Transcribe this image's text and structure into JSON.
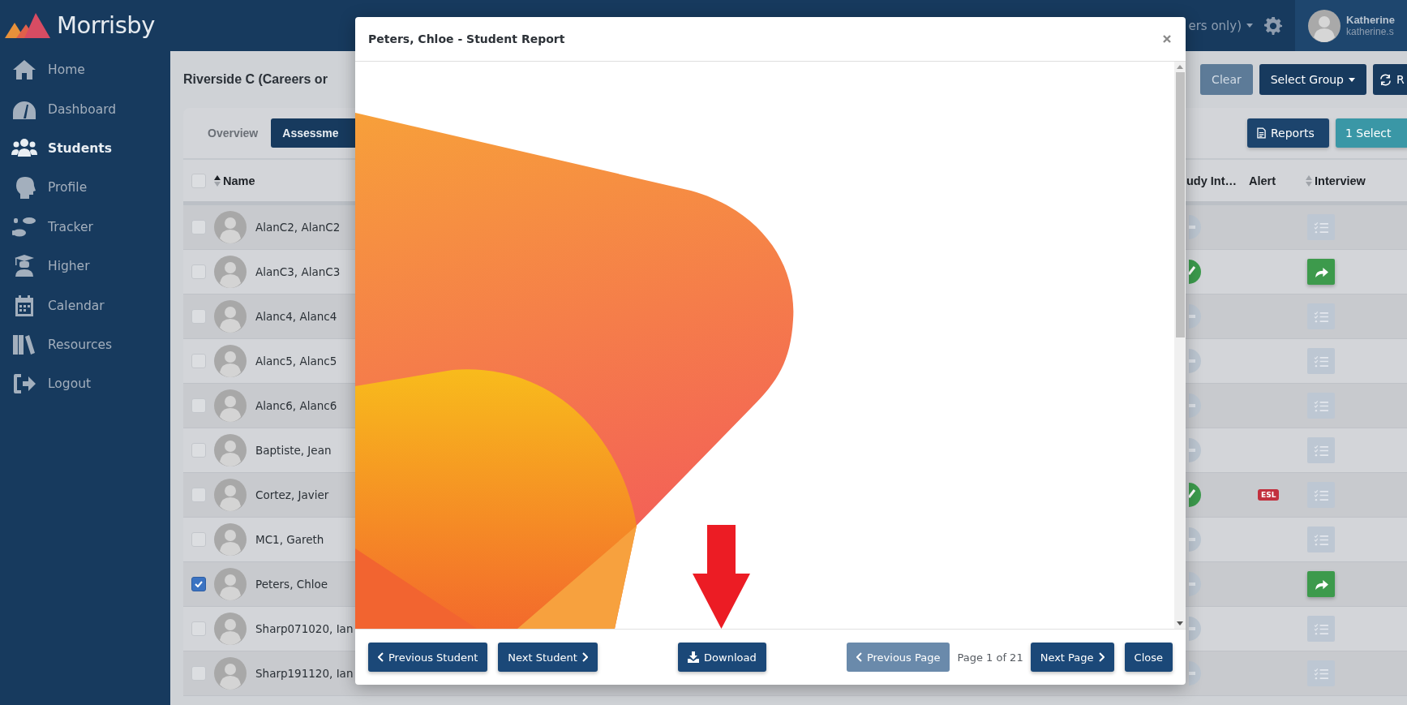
{
  "brand": {
    "name": "Morrisby"
  },
  "sidebar": {
    "items": [
      {
        "label": "Home",
        "selected": false
      },
      {
        "label": "Dashboard",
        "selected": false
      },
      {
        "label": "Students",
        "selected": true
      },
      {
        "label": "Profile",
        "selected": false
      },
      {
        "label": "Tracker",
        "selected": false
      },
      {
        "label": "Higher",
        "selected": false
      },
      {
        "label": "Calendar",
        "selected": false
      },
      {
        "label": "Resources",
        "selected": false
      },
      {
        "label": "Logout",
        "selected": false
      }
    ]
  },
  "top_bar": {
    "group_selector": "ers only)",
    "user": {
      "name": "Katherine",
      "email": "katherine.s"
    }
  },
  "page": {
    "title": "Riverside C (Careers or",
    "toolbar": [
      {
        "label": "Clear",
        "kind": "muted"
      },
      {
        "label": "Select Group",
        "kind": "dropdown"
      },
      {
        "label": "R",
        "kind": "refresh"
      }
    ]
  },
  "tabs": [
    {
      "label": "Overview",
      "selected": false
    },
    {
      "label": "Assessme",
      "selected": true
    }
  ],
  "actions": [
    {
      "label": "Reports",
      "kind": "reports"
    },
    {
      "label": "1 Select",
      "kind": "teal"
    }
  ],
  "table": {
    "select_all": {
      "checked": false
    },
    "columns": [
      {
        "label": "Name",
        "kind": "sorted"
      },
      {
        "label": "udy Int…",
        "kind": "plain"
      },
      {
        "label": "Alert",
        "kind": "plain"
      },
      {
        "label": "Interview",
        "kind": "sortable"
      }
    ],
    "rows": [
      {
        "name": "AlanC2, AlanC2",
        "checked": false,
        "study_complete": false,
        "interview_done": false
      },
      {
        "name": "AlanC3, AlanC3",
        "checked": false,
        "study_complete": true,
        "interview_done": true
      },
      {
        "name": "Alanc4, Alanc4",
        "checked": false,
        "study_complete": false,
        "interview_done": false
      },
      {
        "name": "Alanc5, Alanc5",
        "checked": false,
        "study_complete": false,
        "interview_done": false
      },
      {
        "name": "Alanc6, Alanc6",
        "checked": false,
        "study_complete": false,
        "interview_done": false
      },
      {
        "name": "Baptiste, Jean",
        "checked": false,
        "study_complete": false,
        "interview_done": false
      },
      {
        "name": "Cortez, Javier",
        "checked": false,
        "study_complete": true,
        "alert": "ESL",
        "interview_done": false
      },
      {
        "name": "MC1, Gareth",
        "checked": false,
        "study_complete": false,
        "interview_done": false
      },
      {
        "name": "Peters, Chloe",
        "checked": true,
        "study_complete": false,
        "interview_done": true
      },
      {
        "name": "Sharp071020, Ian",
        "checked": false,
        "study_complete": false,
        "interview_done": false
      },
      {
        "name": "Sharp191120, Ian",
        "checked": false,
        "study_complete": false,
        "interview_done": false
      }
    ]
  },
  "modal": {
    "title": "Peters, Chloe - Student Report",
    "footer": {
      "groups": [
        [
          {
            "kind": "previous",
            "label": "Previous Student",
            "disabled": false
          },
          {
            "kind": "next",
            "label": "Next Student",
            "disabled": false
          }
        ],
        [
          {
            "kind": "download",
            "label": "Download",
            "disabled": false
          }
        ],
        [
          {
            "kind": "previous",
            "label": "Previous Page",
            "disabled": true
          },
          {
            "kind": "indicator",
            "label": "Page 1 of 21"
          },
          {
            "kind": "next",
            "label": "Next Page",
            "disabled": false
          },
          {
            "kind": "close",
            "label": "Close",
            "disabled": false
          }
        ]
      ]
    }
  }
}
